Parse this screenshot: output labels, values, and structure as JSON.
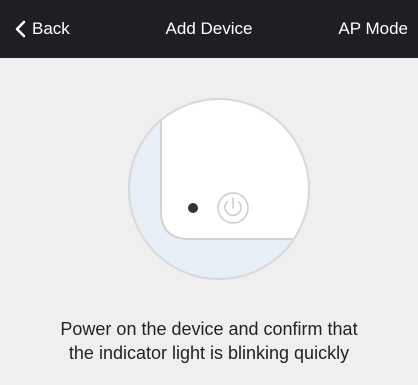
{
  "header": {
    "back_label": "Back",
    "title": "Add Device",
    "mode_label": "AP Mode"
  },
  "icons": {
    "back": "chevron-left-icon",
    "power": "power-icon",
    "indicator": "indicator-light-icon"
  },
  "instruction": {
    "line1": "Power on the device and confirm that",
    "line2": "the indicator light is blinking quickly"
  },
  "colors": {
    "header_bg": "#1f1f23",
    "page_bg": "#efefef",
    "circle_fill": "#ffffff",
    "device_tint": "#e8eff7",
    "outline": "#d7d7d7"
  }
}
